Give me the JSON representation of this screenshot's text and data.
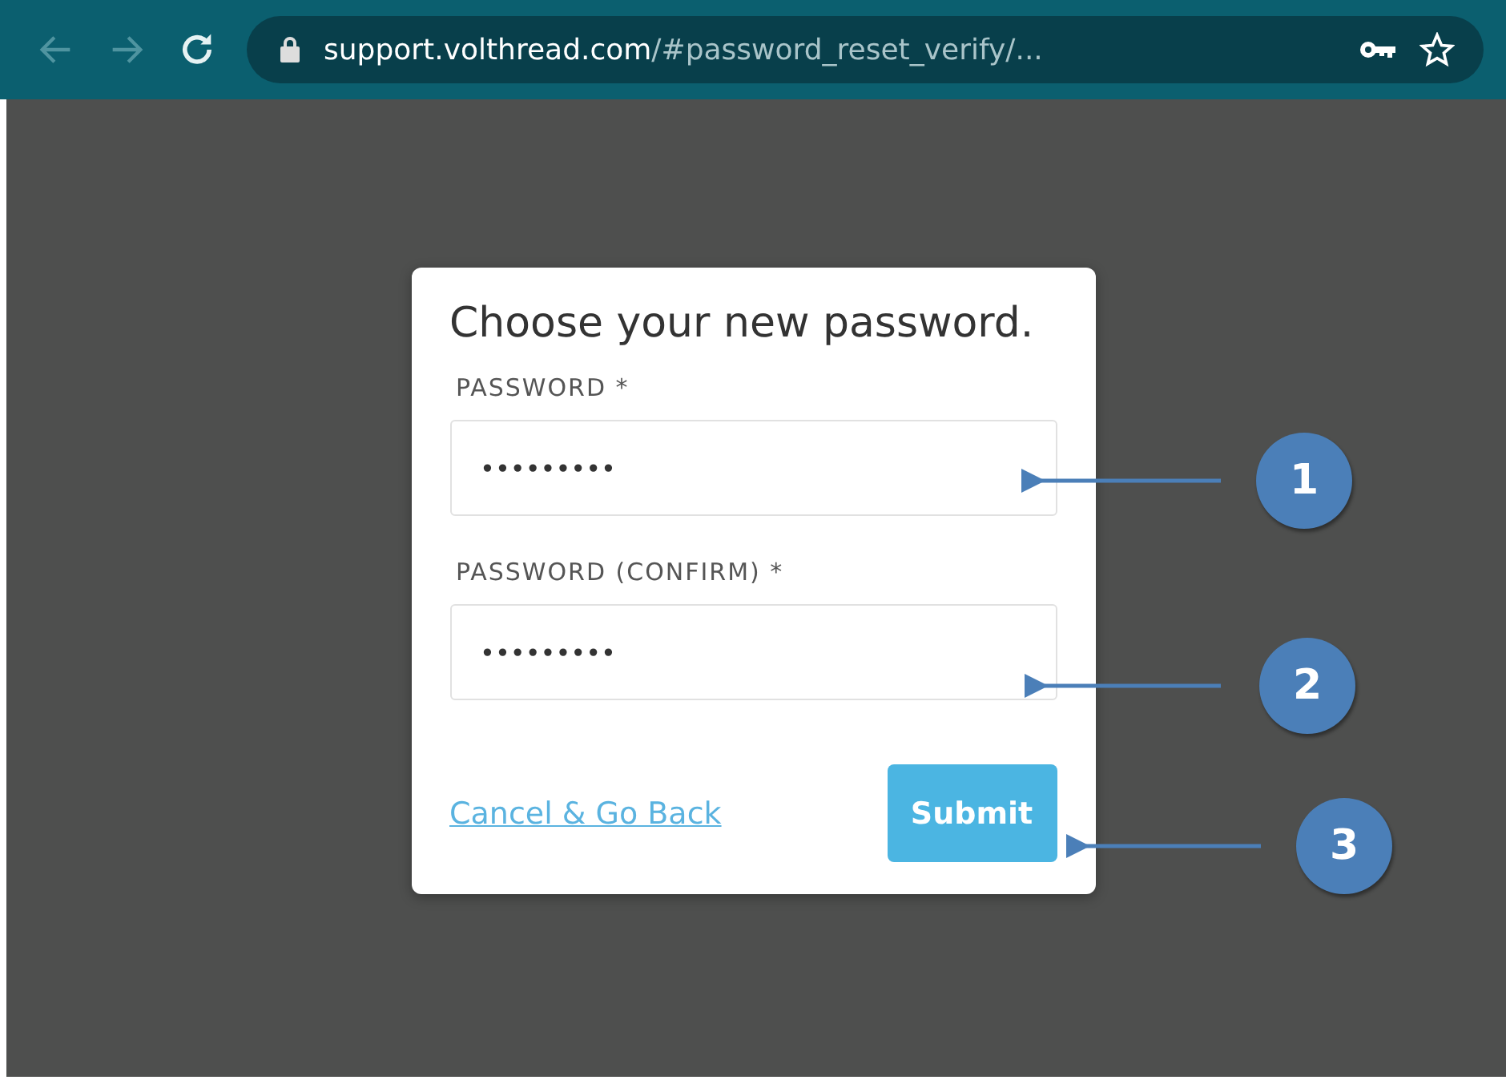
{
  "browser": {
    "url_host": "support.volthread.com",
    "url_path": "/#password_reset_verify/..."
  },
  "form": {
    "title": "Choose your new password.",
    "fields": [
      {
        "label": "PASSWORD *",
        "value": "•••••••••"
      },
      {
        "label": "PASSWORD (CONFIRM) *",
        "value": "•••••••••"
      }
    ],
    "cancel_link": "Cancel & Go Back",
    "submit_button": "Submit"
  },
  "callouts": [
    "1",
    "2",
    "3"
  ]
}
